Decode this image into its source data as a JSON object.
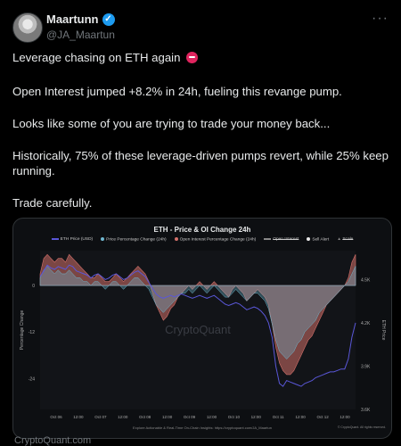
{
  "tweet": {
    "author_name": "Maartunn",
    "handle": "@JA_Maartun",
    "more_label": "···",
    "line1": "Leverage chasing on ETH again",
    "line2": "Open Interest jumped +8.2% in 24h, fueling this revange pump.",
    "line3": "Looks like some of you are trying to trade your money back...",
    "line4": "Historically, 75% of these leverage-driven pumps revert, while 25% keep running.",
    "line5": "Trade carefully.",
    "link_preview": "CryptoQuant.com"
  },
  "colors": {
    "verified": "#1d9bf0",
    "price_line": "#5a57d8",
    "price_change": "#6fb7cf",
    "oi_change": "#d2706a",
    "background": "#000000"
  },
  "chart_data": {
    "type": "area",
    "title": "ETH - Price & OI Change 24h",
    "legend": [
      "ETH Price (USD)",
      "Price Percentage Change (24h)",
      "Open Interest Percentage Change (24h)",
      "Open Interest",
      "Sell Alert",
      "Scale"
    ],
    "ylabel_left": "Percentage Change",
    "ylabel_right": "ETH Price",
    "left_ticks": [
      "0",
      "-12",
      "-24"
    ],
    "right_ticks": [
      "4.5K",
      "4.2K",
      "3.9K",
      "3.6K"
    ],
    "x_ticks": [
      "Oct 06",
      "12:00",
      "Oct 07",
      "12:00",
      "Oct 08",
      "12:00",
      "Oct 09",
      "12:00",
      "Oct 10",
      "12:00",
      "Oct 11",
      "12:00",
      "Oct 12",
      "12:00"
    ],
    "ylim_left": [
      -32,
      9
    ],
    "ylim_right": [
      3600,
      4700
    ],
    "watermark": "CryptoQuant",
    "footer": "Explore Actionable & Real-Time On-Chain Insights: https://cryptoquant.com/JA_Maartun",
    "copyright": "© CryptoQuant. All rights reserved.",
    "oi_change": [
      3,
      7,
      8,
      7,
      6,
      7,
      7,
      6,
      8,
      7,
      6,
      5,
      4,
      3,
      2,
      2,
      3,
      2,
      1,
      1,
      2,
      3,
      2,
      1,
      2,
      3,
      4,
      5,
      4,
      3,
      1,
      -2,
      -5,
      -7,
      -9,
      -8,
      -6,
      -5,
      -3,
      -2,
      -1,
      0,
      -1,
      0,
      1,
      0,
      -1,
      0,
      1,
      0,
      -1,
      -2,
      -3,
      -1,
      0,
      -1,
      -2,
      -4,
      -3,
      -2,
      -1,
      -2,
      -3,
      -5,
      -10,
      -16,
      -20,
      -22,
      -23,
      -23,
      -22,
      -20,
      -18,
      -16,
      -14,
      -13,
      -11,
      -9,
      -7,
      -5,
      -4,
      -3,
      -2,
      -1,
      0,
      2,
      6,
      8
    ],
    "price_change": [
      2,
      4,
      5,
      4,
      3,
      4,
      3,
      3,
      4,
      3,
      2,
      2,
      1,
      1,
      0,
      1,
      1,
      0,
      -1,
      0,
      1,
      1,
      0,
      -1,
      0,
      1,
      2,
      2,
      1,
      0,
      -1,
      -3,
      -5,
      -6,
      -7,
      -6,
      -5,
      -4,
      -3,
      -2,
      -2,
      -1,
      -2,
      -1,
      0,
      -1,
      -2,
      -1,
      0,
      -1,
      -2,
      -3,
      -3,
      -2,
      -1,
      -2,
      -3,
      -4,
      -3,
      -2,
      -2,
      -3,
      -4,
      -6,
      -10,
      -14,
      -17,
      -18,
      -19,
      -18,
      -17,
      -15,
      -14,
      -12,
      -11,
      -10,
      -9,
      -7,
      -6,
      -5,
      -4,
      -3,
      -2,
      -1,
      0,
      1,
      3,
      5
    ],
    "price": [
      4520,
      4560,
      4600,
      4580,
      4570,
      4590,
      4580,
      4570,
      4600,
      4590,
      4560,
      4550,
      4540,
      4530,
      4510,
      4530,
      4540,
      4520,
      4500,
      4510,
      4530,
      4540,
      4520,
      4500,
      4510,
      4530,
      4550,
      4560,
      4540,
      4520,
      4480,
      4440,
      4400,
      4380,
      4370,
      4380,
      4390,
      4380,
      4390,
      4400,
      4390,
      4380,
      4370,
      4380,
      4390,
      4380,
      4370,
      4380,
      4390,
      4370,
      4350,
      4330,
      4320,
      4330,
      4340,
      4330,
      4310,
      4290,
      4300,
      4310,
      4300,
      4280,
      4250,
      4200,
      4100,
      3900,
      3780,
      3760,
      3800,
      3790,
      3780,
      3770,
      3760,
      3780,
      3790,
      3800,
      3820,
      3830,
      3840,
      3850,
      3860,
      3860,
      3870,
      3880,
      3880,
      3950,
      4100,
      4200
    ]
  }
}
